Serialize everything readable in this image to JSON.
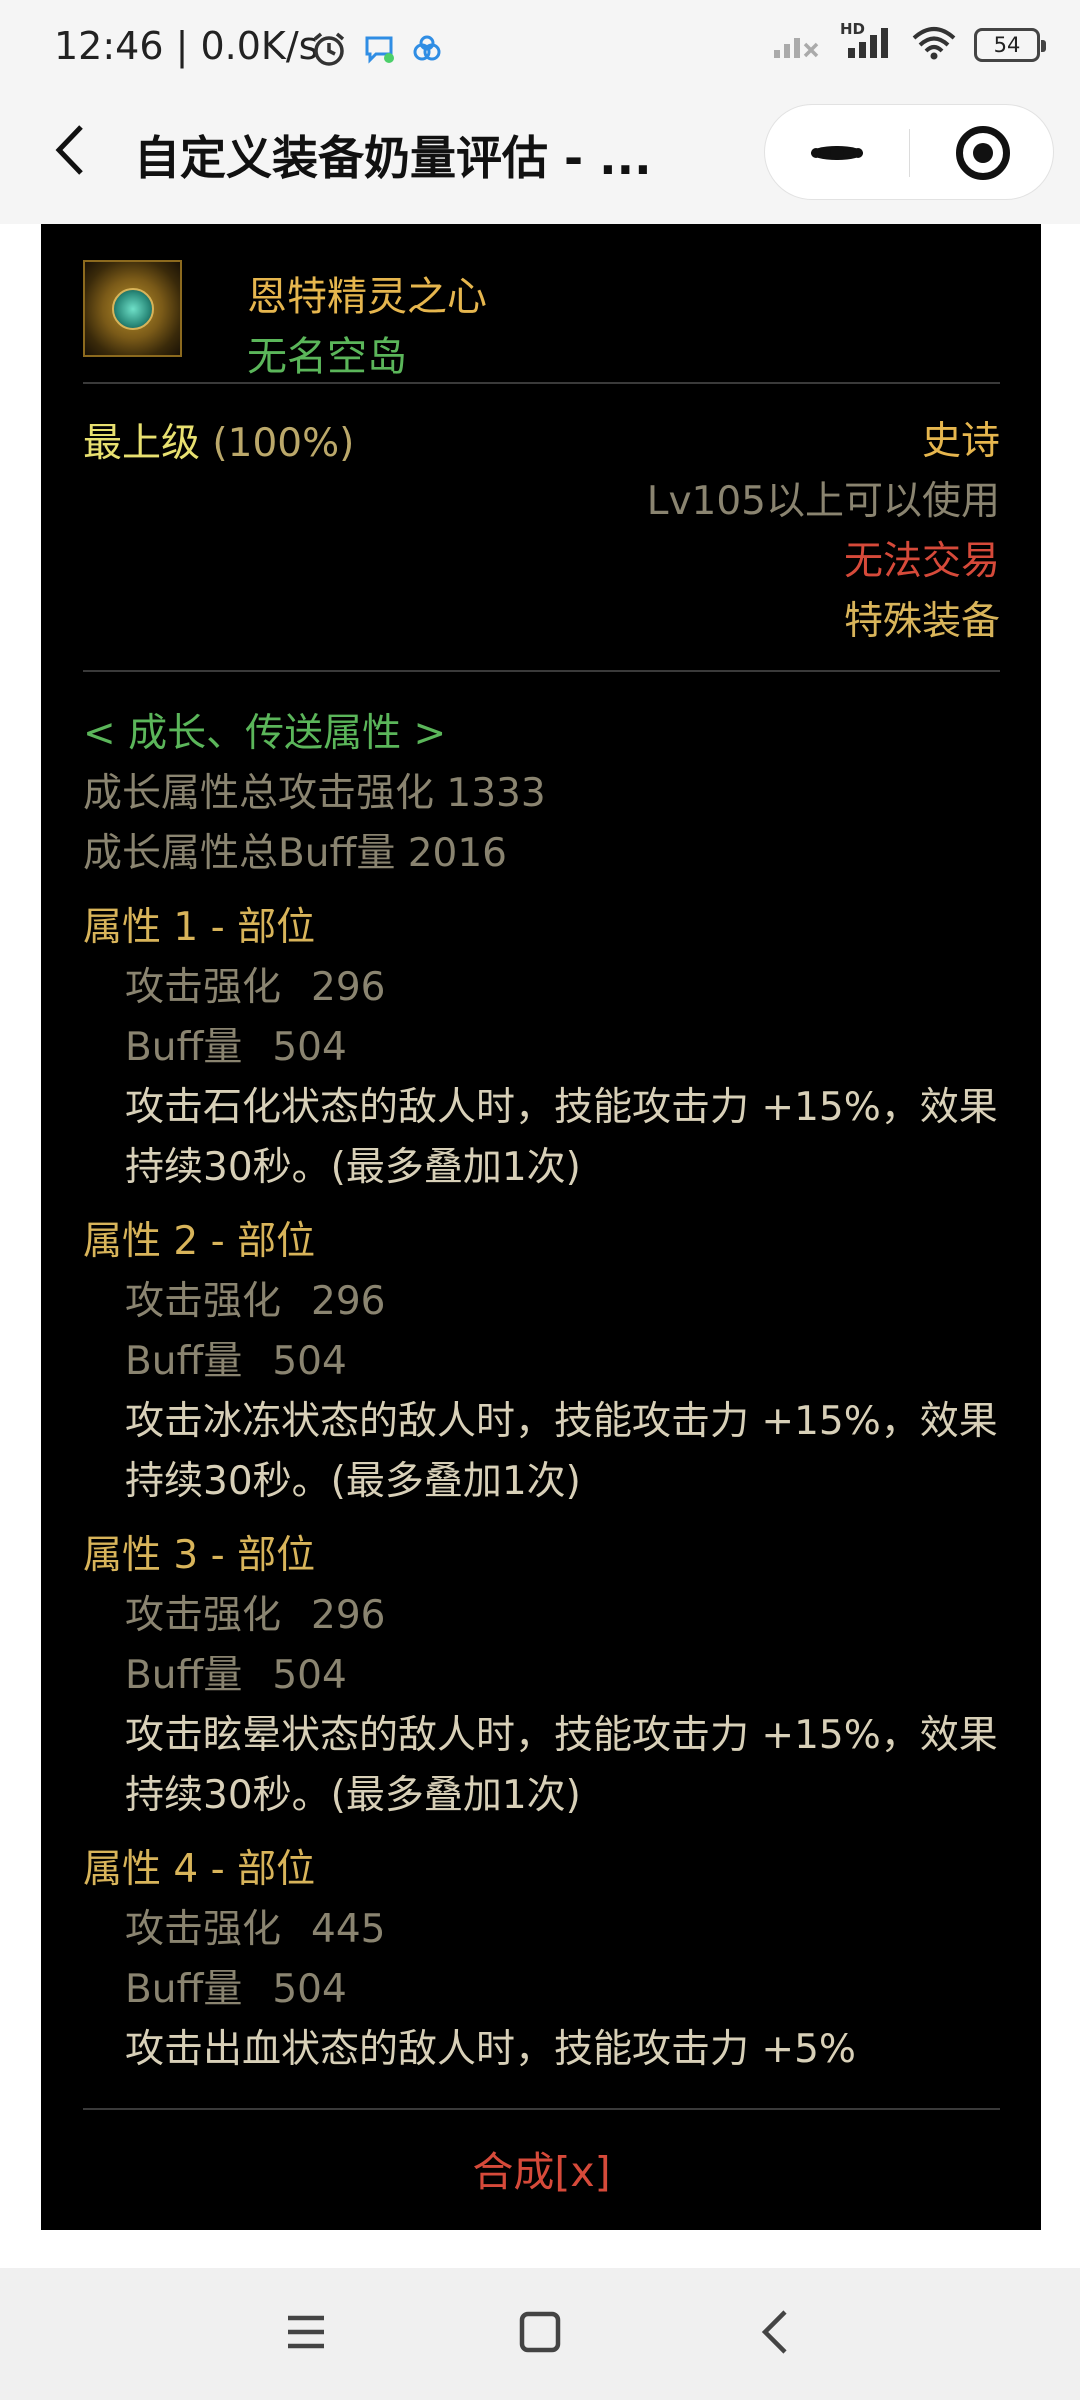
{
  "status_bar": {
    "time_speed": "12:46 | 0.0K/s",
    "battery": "54",
    "net_badge": "HD"
  },
  "nav": {
    "title": "自定义装备奶量评估 - ..."
  },
  "item": {
    "name": "恩特精灵之心",
    "source": "无名空岛",
    "tier_label": "最上级",
    "tier_pct": "(100%)",
    "rarity": "史诗",
    "level_req": "Lv105以上可以使用",
    "trade": "无法交易",
    "type": "特殊装备"
  },
  "growth": {
    "title": "< 成长、传送属性 >",
    "total_attack": "成长属性总攻击强化 1333",
    "total_buff": "成长属性总Buff量 2016"
  },
  "attributes": [
    {
      "title": "属性 1 - 部位",
      "attack_label": "攻击强化",
      "attack_value": "296",
      "buff_label": "Buff量",
      "buff_value": "504",
      "desc": "攻击石化状态的敌人时，技能攻击力 +15%，效果持续30秒。(最多叠加1次)"
    },
    {
      "title": "属性 2 - 部位",
      "attack_label": "攻击强化",
      "attack_value": "296",
      "buff_label": "Buff量",
      "buff_value": "504",
      "desc": "攻击冰冻状态的敌人时，技能攻击力 +15%，效果持续30秒。(最多叠加1次)"
    },
    {
      "title": "属性 3 - 部位",
      "attack_label": "攻击强化",
      "attack_value": "296",
      "buff_label": "Buff量",
      "buff_value": "504",
      "desc": "攻击眩晕状态的敌人时，技能攻击力 +15%，效果持续30秒。(最多叠加1次)"
    },
    {
      "title": "属性 4 - 部位",
      "attack_label": "攻击强化",
      "attack_value": "445",
      "buff_label": "Buff量",
      "buff_value": "504",
      "desc": "攻击出血状态的敌人时，技能攻击力 +5%"
    }
  ],
  "synthesis_label": "合成[x]",
  "icons": {
    "back": "back-arrow-icon",
    "more": "more-dots-icon",
    "close": "target-close-icon",
    "menu": "menu-icon",
    "home": "home-square-icon",
    "sys_back": "back-chevron-icon"
  }
}
